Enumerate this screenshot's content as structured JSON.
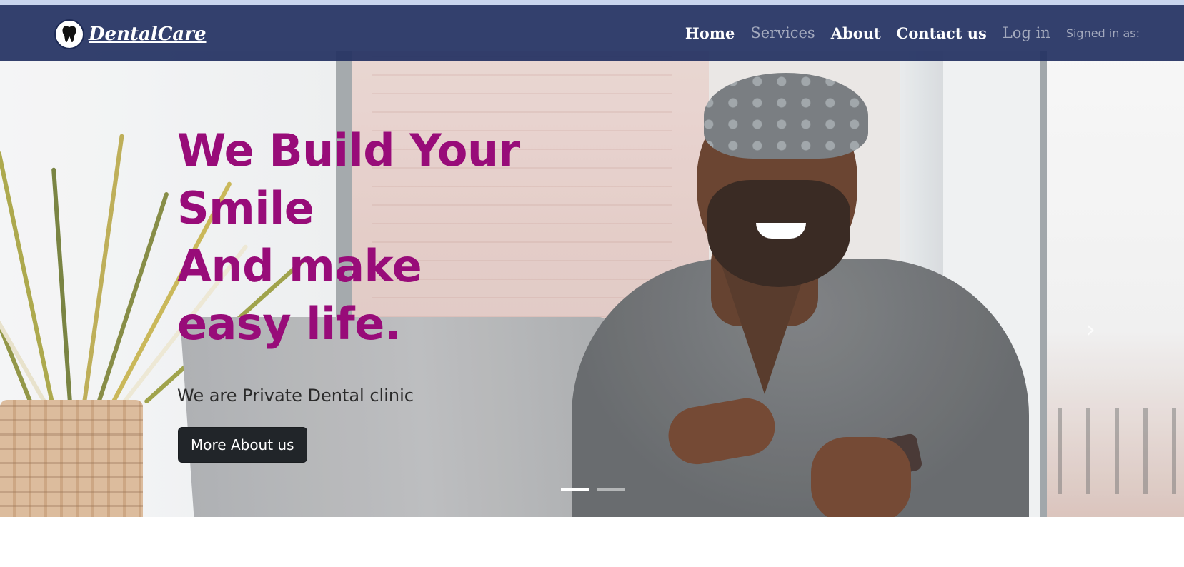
{
  "brand": {
    "name": "DentalCare",
    "logo_icon": "tooth-icon"
  },
  "nav": {
    "items": [
      {
        "label": "Home",
        "active": true
      },
      {
        "label": "Services",
        "active": false
      },
      {
        "label": "About",
        "active": true
      },
      {
        "label": "Contact us",
        "active": true
      }
    ],
    "login_label": "Log in",
    "signed_in_label": "Signed in as:"
  },
  "hero": {
    "headline_lines": [
      "We Build Your",
      "Smile",
      "And make",
      "easy life."
    ],
    "subheadline": "We are Private Dental clinic",
    "cta_label": "More About us",
    "slides_total": 2,
    "active_slide": 1
  },
  "colors": {
    "navbar": "#243262",
    "headline": "#980c79",
    "cta_bg": "#212529",
    "top_strip": "#c9d5ee"
  }
}
